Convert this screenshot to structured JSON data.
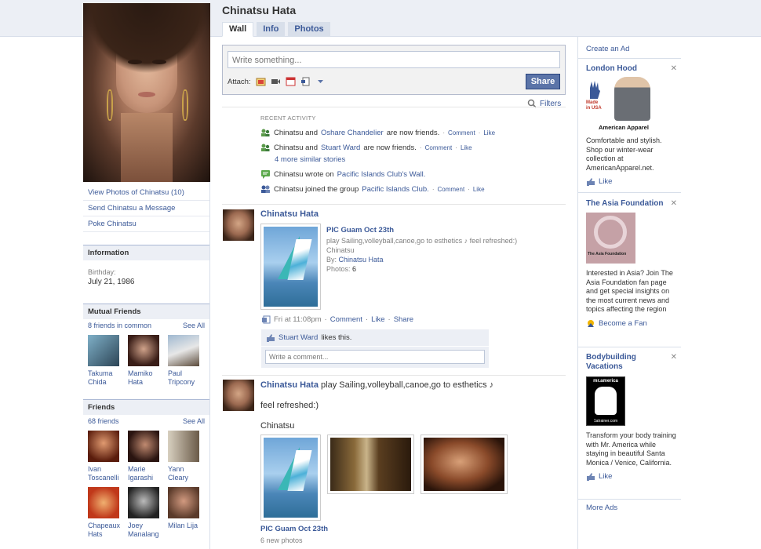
{
  "profile": {
    "name": "Chinatsu Hata",
    "left_links": [
      "View Photos of Chinatsu (10)",
      "Send Chinatsu a Message",
      "Poke Chinatsu"
    ],
    "information": {
      "heading": "Information",
      "birthday_label": "Birthday:",
      "birthday_value": "July 21, 1986"
    },
    "mutual_friends": {
      "heading": "Mutual Friends",
      "count": "8 friends in common",
      "see_all": "See All",
      "items": [
        {
          "first": "Takuma",
          "last": "Chida"
        },
        {
          "first": "Mamiko",
          "last": "Hata"
        },
        {
          "first": "Paul",
          "last": "Tripcony"
        }
      ]
    },
    "friends": {
      "heading": "Friends",
      "count": "68 friends",
      "see_all": "See All",
      "items": [
        {
          "first": "Ivan",
          "last": "Toscanelli"
        },
        {
          "first": "Marie",
          "last": "Igarashi"
        },
        {
          "first": "Yann",
          "last": "Cleary"
        },
        {
          "first": "Chapeaux",
          "last": "Hats"
        },
        {
          "first": "Joey",
          "last": "Manalang"
        },
        {
          "first": "Milan Lija",
          "last": ""
        }
      ]
    }
  },
  "tabs": [
    {
      "label": "Wall",
      "active": true
    },
    {
      "label": "Info",
      "active": false
    },
    {
      "label": "Photos",
      "active": false
    }
  ],
  "composer": {
    "placeholder": "Write something...",
    "attach_label": "Attach:",
    "share_label": "Share"
  },
  "filters_label": "Filters",
  "recent_activity": {
    "heading": "RECENT ACTIVITY",
    "items": [
      {
        "pre": "Chinatsu and",
        "link": "Oshare Chandelier",
        "post": "are now friends.",
        "actions": [
          "Comment",
          "Like"
        ],
        "icon": "friends-icon"
      },
      {
        "pre": "Chinatsu and",
        "link": "Stuart Ward",
        "post": "are now friends.",
        "actions": [
          "Comment",
          "Like"
        ],
        "icon": "friends-icon"
      },
      {
        "pre": "",
        "link": "4 more similar stories",
        "post": "",
        "actions": [],
        "icon": ""
      },
      {
        "pre": "Chinatsu wrote on",
        "link": "Pacific Islands Club's Wall.",
        "post": "",
        "actions": [],
        "icon": "wall-post-icon"
      },
      {
        "pre": "Chinatsu joined the group",
        "link": "Pacific Islands Club.",
        "post": "",
        "actions": [
          "Comment",
          "Like"
        ],
        "icon": "group-icon"
      }
    ]
  },
  "story1": {
    "author": "Chinatsu Hata",
    "album_title": "PIC Guam Oct 23th",
    "caption": "play Sailing,volleyball,canoe,go to esthetics ♪ feel refreshed:)",
    "caption2": "Chinatsu",
    "by_label": "By:",
    "by_value": "Chinatsu Hata",
    "photos_label": "Photos:",
    "photos_value": "6",
    "time": "Fri at 11:08pm",
    "actions": [
      "Comment",
      "Like",
      "Share"
    ],
    "liker": "Stuart Ward",
    "likes_suffix": "likes this.",
    "comment_placeholder": "Write a comment..."
  },
  "story2": {
    "author": "Chinatsu Hata",
    "text1": "play Sailing,volleyball,canoe,go to esthetics ♪",
    "text2": "feel refreshed:)",
    "text3": "Chinatsu",
    "album_title": "PIC Guam Oct 23th",
    "new_photos": "6 new photos"
  },
  "right": {
    "create_ad": "Create an Ad",
    "more_ads": "More Ads",
    "ads": [
      {
        "title": "London Hood",
        "brand": "American Apparel",
        "badge": "Made in USA",
        "text": "Comfortable and stylish. Shop our winter-wear collection at AmericanApparel.net.",
        "action": "Like"
      },
      {
        "title": "The Asia Foundation",
        "brand": "The Asia Foundation",
        "text": "Interested in Asia? Join The Asia Foundation fan page and get special insights on the most current news and topics affecting the region",
        "action": "Become a Fan"
      },
      {
        "title": "Bodybuilding Vacations",
        "brand_top": "mr.america",
        "brand_bottom": "1atrainer.com",
        "text": "Transform your body training with Mr. America while staying in beautiful Santa Monica / Venice, California.",
        "action": "Like"
      }
    ]
  },
  "colors": {
    "link": "#3b5998",
    "share_button": "#5b74a8",
    "header_bg": "#eceff5"
  }
}
